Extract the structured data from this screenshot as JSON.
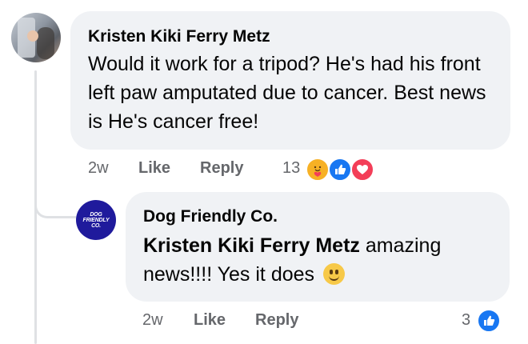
{
  "comment": {
    "author": "Kristen Kiki Ferry Metz",
    "text": "Would it work for a tripod? He's had his front left paw amputated due to cancer. Best news is He's cancer free!",
    "time": "2w",
    "like_label": "Like",
    "reply_label": "Reply",
    "reaction_count": "13",
    "reactions": [
      "care-icon",
      "like-icon",
      "love-icon"
    ]
  },
  "reply": {
    "author": "Dog Friendly Co.",
    "avatar_text": [
      "DOG",
      "FRIENDLY",
      "CO."
    ],
    "mention": "Kristen Kiki Ferry Metz",
    "text": " amazing news!!!! Yes it does",
    "emoji": "smile-emoji",
    "time": "2w",
    "like_label": "Like",
    "reply_label": "Reply",
    "reaction_count": "3",
    "reactions": [
      "like-icon"
    ]
  },
  "colors": {
    "bubble": "#f0f2f5",
    "meta_text": "#65676b",
    "like_blue": "#1877f2",
    "love_red": "#f33e58",
    "brand_avatar": "#1f1a9c"
  }
}
